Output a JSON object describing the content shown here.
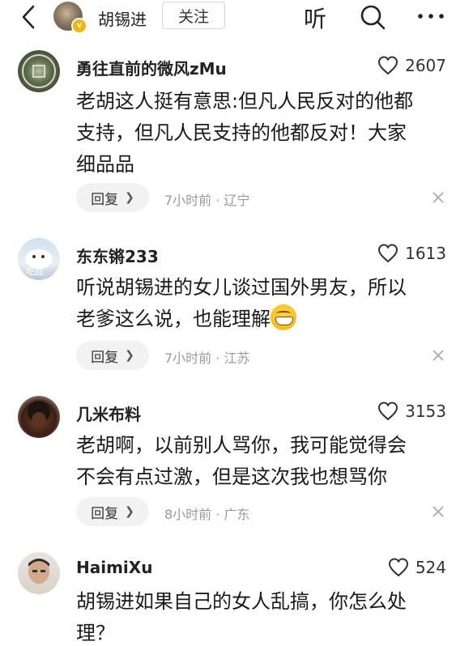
{
  "header": {
    "user_name": "胡锡进",
    "follow_label": "关注",
    "listen_label": "听",
    "back_icon": "chevron-left-icon",
    "search_icon": "search-icon",
    "more_icon": "more-icon"
  },
  "comments": [
    {
      "username": "勇往直前的微风zMu",
      "likes": "2607",
      "lines": [
        "老胡这人挺有意思:但凡人民反对的他都",
        "支持，但凡人民支持的他都反对！大家",
        "细品品"
      ],
      "reply_label": "回复",
      "meta": "7小时前 · 辽宁"
    },
    {
      "username": "东东锵233",
      "likes": "1613",
      "lines": [
        "听说胡锡进的女儿谈过国外男友，所以",
        "老爹这么说，也能理解"
      ],
      "reply_label": "回复",
      "meta": "7小时前 · 江苏",
      "avatar_text": "吃屁"
    },
    {
      "username": "几米布料",
      "likes": "3153",
      "lines": [
        "老胡啊，以前别人骂你，我可能觉得会",
        "不会有点过激，但是这次我也想骂你"
      ],
      "reply_label": "回复",
      "meta": "8小时前 · 广东"
    },
    {
      "username": "HaimiXu",
      "likes": "524",
      "lines": [
        "胡锡进如果自己的女人乱搞，你怎么处",
        "理？"
      ]
    }
  ]
}
